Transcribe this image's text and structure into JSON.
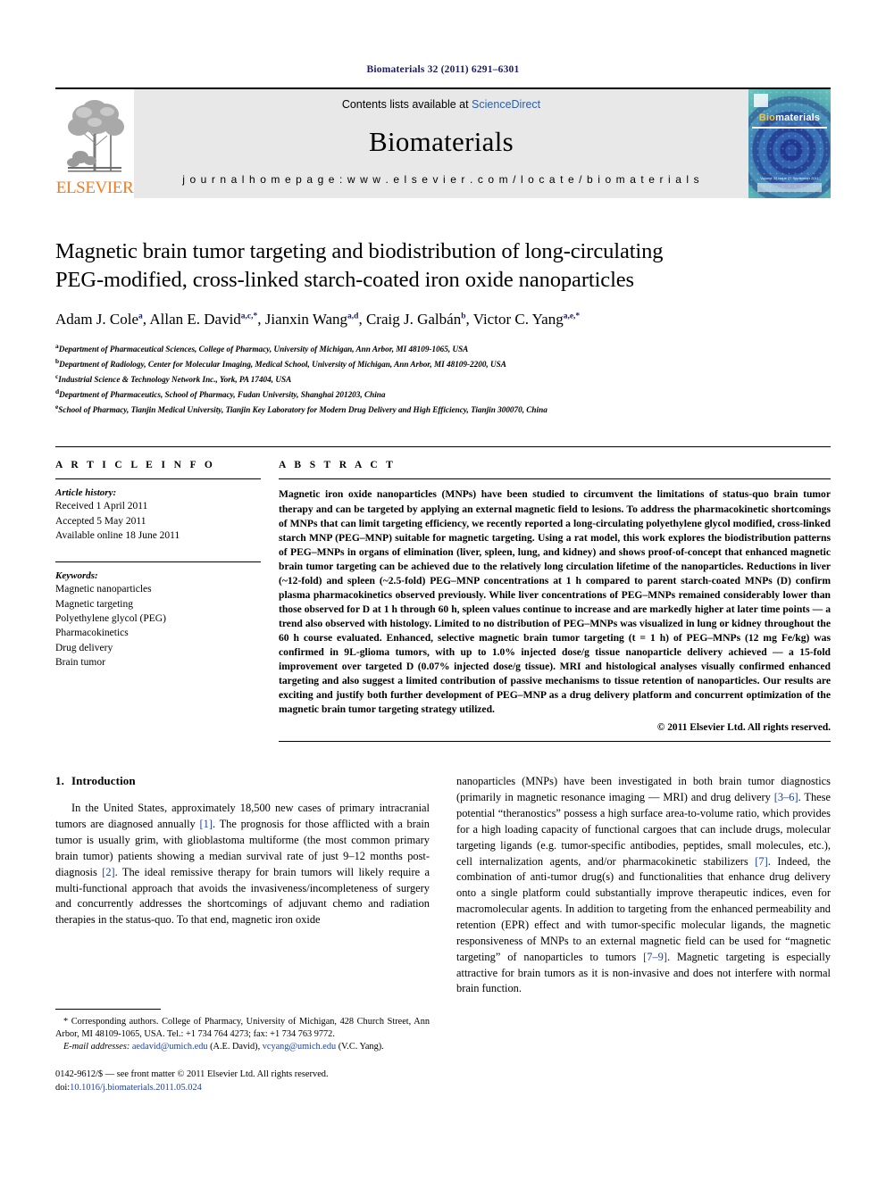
{
  "running_head": "Biomaterials 32 (2011) 6291–6301",
  "masthead": {
    "elsevier_wordmark": "ELSEVIER",
    "contents_prefix": "Contents lists available at ",
    "sciencedirect": "ScienceDirect",
    "journal_name": "Biomaterials",
    "homepage": "j o u r n a l   h o m e p a g e :   w w w . e l s e v i e r . c o m / l o c a t e / b i o m a t e r i a l s",
    "cover_title_bio": "Bio",
    "cover_title_materials": "materials",
    "cover_caption": "Volume 32  Issue 27  September 2011",
    "colors": {
      "elsevier_orange": "#f47c20",
      "link_blue": "#2b5fa8",
      "header_navy": "#1c1c66",
      "masthead_grey": "#e8e8e8",
      "cover_teal": "#3aa0a8"
    }
  },
  "article": {
    "title_line1": "Magnetic brain tumor targeting and biodistribution of long-circulating",
    "title_line2": "PEG-modified, cross-linked starch-coated iron oxide nanoparticles",
    "authors": [
      {
        "name": "Adam J. Cole",
        "sup": "a",
        "sep": ", "
      },
      {
        "name": "Allan E. David",
        "sup": "a,c,*",
        "sep": ", "
      },
      {
        "name": "Jianxin Wang",
        "sup": "a,d",
        "sep": ", "
      },
      {
        "name": "Craig J. Galbán",
        "sup": "b",
        "sep": ", "
      },
      {
        "name": "Victor C. Yang",
        "sup": "a,e,*",
        "sep": ""
      }
    ],
    "affiliations": [
      {
        "marker": "a",
        "text": "Department of Pharmaceutical Sciences, College of Pharmacy, University of Michigan, Ann Arbor, MI 48109-1065, USA"
      },
      {
        "marker": "b",
        "text": "Department of Radiology, Center for Molecular Imaging, Medical School, University of Michigan, Ann Arbor, MI 48109-2200, USA"
      },
      {
        "marker": "c",
        "text": "Industrial Science & Technology Network Inc., York, PA 17404, USA"
      },
      {
        "marker": "d",
        "text": "Department of Pharmaceutics, School of Pharmacy, Fudan University, Shanghai 201203, China"
      },
      {
        "marker": "e",
        "text": "School of Pharmacy, Tianjin Medical University, Tianjin Key Laboratory for Modern Drug Delivery and High Efficiency, Tianjin 300070, China"
      }
    ]
  },
  "article_info": {
    "heading": "A R T I C L E   I N F O",
    "history_label": "Article history:",
    "history": [
      "Received 1 April 2011",
      "Accepted 5 May 2011",
      "Available online 18 June 2011"
    ],
    "keywords_label": "Keywords:",
    "keywords": [
      "Magnetic nanoparticles",
      "Magnetic targeting",
      "Polyethylene glycol (PEG)",
      "Pharmacokinetics",
      "Drug delivery",
      "Brain tumor"
    ]
  },
  "abstract": {
    "heading": "A B S T R A C T",
    "text": "Magnetic iron oxide nanoparticles (MNPs) have been studied to circumvent the limitations of status-quo brain tumor therapy and can be targeted by applying an external magnetic field to lesions. To address the pharmacokinetic shortcomings of MNPs that can limit targeting efficiency, we recently reported a long-circulating polyethylene glycol modified, cross-linked starch MNP (PEG–MNP) suitable for magnetic targeting. Using a rat model, this work explores the biodistribution patterns of PEG–MNPs in organs of elimination (liver, spleen, lung, and kidney) and shows proof-of-concept that enhanced magnetic brain tumor targeting can be achieved due to the relatively long circulation lifetime of the nanoparticles. Reductions in liver (~12-fold) and spleen (~2.5-fold) PEG–MNP concentrations at 1 h compared to parent starch-coated MNPs (D) confirm plasma pharmacokinetics observed previously. While liver concentrations of PEG–MNPs remained considerably lower than those observed for D at 1 h through 60 h, spleen values continue to increase and are markedly higher at later time points — a trend also observed with histology. Limited to no distribution of PEG–MNPs was visualized in lung or kidney throughout the 60 h course evaluated. Enhanced, selective magnetic brain tumor targeting (t = 1 h) of PEG–MNPs (12 mg Fe/kg) was confirmed in 9L-glioma tumors, with up to 1.0% injected dose/g tissue nanoparticle delivery achieved — a 15-fold improvement over targeted D (0.07% injected dose/g tissue). MRI and histological analyses visually confirmed enhanced targeting and also suggest a limited contribution of passive mechanisms to tissue retention of nanoparticles. Our results are exciting and justify both further development of PEG–MNP as a drug delivery platform and concurrent optimization of the magnetic brain tumor targeting strategy utilized.",
    "copyright": "© 2011 Elsevier Ltd. All rights reserved."
  },
  "introduction": {
    "number": "1.",
    "heading": "Introduction",
    "left_para_part1": "In the United States, approximately 18,500 new cases of primary intracranial tumors are diagnosed annually ",
    "ref1": "[1]",
    "left_para_part2": ". The prognosis for those afflicted with a brain tumor is usually grim, with glioblastoma multiforme (the most common primary brain tumor) patients showing a median survival rate of just 9–12 months post-diagnosis ",
    "ref2": "[2]",
    "left_para_part3": ". The ideal remissive therapy for brain tumors will likely require a multi-functional approach that avoids the invasiveness/incompleteness of surgery and concurrently addresses the shortcomings of adjuvant chemo and radiation therapies in the status-quo. To that end, magnetic iron oxide",
    "right_part1": "nanoparticles (MNPs) have been investigated in both brain tumor diagnostics (primarily in magnetic resonance imaging — MRI) and drug delivery ",
    "ref36": "[3–6]",
    "right_part2": ". These potential “theranostics” possess a high surface area-to-volume ratio, which provides for a high loading capacity of functional cargoes that can include drugs, molecular targeting ligands (e.g. tumor-specific antibodies, peptides, small molecules, etc.), cell internalization agents, and/or pharmacokinetic stabilizers ",
    "ref7": "[7]",
    "right_part3": ". Indeed, the combination of anti-tumor drug(s) and functionalities that enhance drug delivery onto a single platform could substantially improve therapeutic indices, even for macromolecular agents. In addition to targeting from the enhanced permeability and retention (EPR) effect and with tumor-specific molecular ligands, the magnetic responsiveness of MNPs to an external magnetic field can be used for “magnetic targeting” of nanoparticles to tumors ",
    "ref79": "[7–9]",
    "right_part4": ". Magnetic targeting is especially attractive for brain tumors as it is non-invasive and does not interfere with normal brain function."
  },
  "footnote": {
    "corresponding": "* Corresponding authors. College of Pharmacy, University of Michigan, 428 Church Street, Ann Arbor, MI 48109-1065, USA. Tel.: +1 734 764 4273; fax: +1 734 763 9772.",
    "email_label": "E-mail addresses:",
    "email1": "aedavid@umich.edu",
    "email1_owner": " (A.E. David), ",
    "email2": "vcyang@umich.edu",
    "email2_owner": " (V.C. Yang)."
  },
  "issn": {
    "line1": "0142-9612/$ — see front matter © 2011 Elsevier Ltd. All rights reserved.",
    "doi_label": "doi:",
    "doi_value": "10.1016/j.biomaterials.2011.05.024"
  }
}
